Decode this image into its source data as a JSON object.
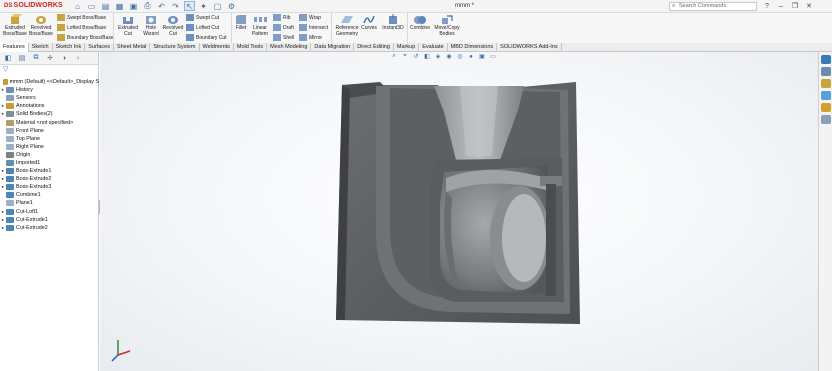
{
  "app": {
    "name": "SOLIDWORKS",
    "logo_prefix": "DS"
  },
  "titlebar": {
    "document_title": "mmm *",
    "search_placeholder": "Search Commands",
    "quick_access": [
      "home-icon",
      "new-file-icon",
      "open-icon",
      "print-icon",
      "undo-icon",
      "select-icon",
      "rebuild-icon",
      "save-icon",
      "options-icon"
    ]
  },
  "ribbon": {
    "extruded_boss": "Extruded Boss/Base",
    "revolved_boss": "Revolved Boss/Base",
    "swept_boss": "Swept Boss/Base",
    "lofted_boss": "Lofted Boss/Base",
    "boundary_boss": "Boundary Boss/Base",
    "extruded_cut": "Extruded Cut",
    "hole_wizard": "Hole Wizard",
    "revolved_cut": "Revolved Cut",
    "swept_cut": "Swept Cut",
    "lofted_cut": "Lofted Cut",
    "boundary_cut": "Boundary Cut",
    "fillet": "Fillet",
    "linear_pattern": "Linear Pattern",
    "rib": "Rib",
    "draft": "Draft",
    "shell": "Shell",
    "wrap": "Wrap",
    "intersect": "Intersect",
    "mirror": "Mirror",
    "reference_geometry": "Reference Geometry",
    "curves": "Curves",
    "instant3d": "Instant3D",
    "combine": "Combine",
    "move_copy_bodies": "Move/Copy Bodies"
  },
  "tabs": [
    "Features",
    "Sketch",
    "Sketch Ink",
    "Surfaces",
    "Sheet Metal",
    "Structure System",
    "Weldments",
    "Mold Tools",
    "Mesh Modeling",
    "Data Migration",
    "Direct Editing",
    "Markup",
    "Evaluate",
    "MBD Dimensions",
    "SOLIDWORKS Add-Ins"
  ],
  "active_tab": "Features",
  "tree": {
    "root": "mmm (Default) <<Default>_Display S",
    "items": [
      {
        "label": "History",
        "expand": "▸",
        "color": "#6d8fb5"
      },
      {
        "label": "Sensors",
        "expand": "",
        "color": "#8aa0b8"
      },
      {
        "label": "Annotations",
        "expand": "▸",
        "color": "#c99c2e"
      },
      {
        "label": "Solid Bodies(2)",
        "expand": "▸",
        "color": "#7a8ea3"
      },
      {
        "label": "Material <not specified>",
        "expand": "",
        "color": "#b59a6a"
      },
      {
        "label": "Front Plane",
        "expand": "",
        "color": "#9bb0c6"
      },
      {
        "label": "Top Plane",
        "expand": "",
        "color": "#9bb0c6"
      },
      {
        "label": "Right Plane",
        "expand": "",
        "color": "#9bb0c6"
      },
      {
        "label": "Origin",
        "expand": "",
        "color": "#7f7f7f"
      },
      {
        "label": "Imported1",
        "expand": "",
        "color": "#5f8fb0"
      },
      {
        "label": "Boss-Extrude1",
        "expand": "▸",
        "color": "#4d86b6"
      },
      {
        "label": "Boss-Extrude2",
        "expand": "▸",
        "color": "#4d86b6"
      },
      {
        "label": "Boss-Extrude3",
        "expand": "▸",
        "color": "#4d86b6"
      },
      {
        "label": "Combine1",
        "expand": "",
        "color": "#4d86b6"
      },
      {
        "label": "Plane1",
        "expand": "",
        "color": "#9bb0c6"
      },
      {
        "label": "Cut-Loft1",
        "expand": "▸",
        "color": "#4d86b6"
      },
      {
        "label": "Cut-Extrude1",
        "expand": "▸",
        "color": "#4d86b6"
      },
      {
        "label": "Cut-Extrude2",
        "expand": "▸",
        "color": "#4d86b6"
      }
    ]
  },
  "colors": {
    "accent": "#3c6ea8",
    "brand": "#d0261d",
    "model": "#5a5c60"
  }
}
